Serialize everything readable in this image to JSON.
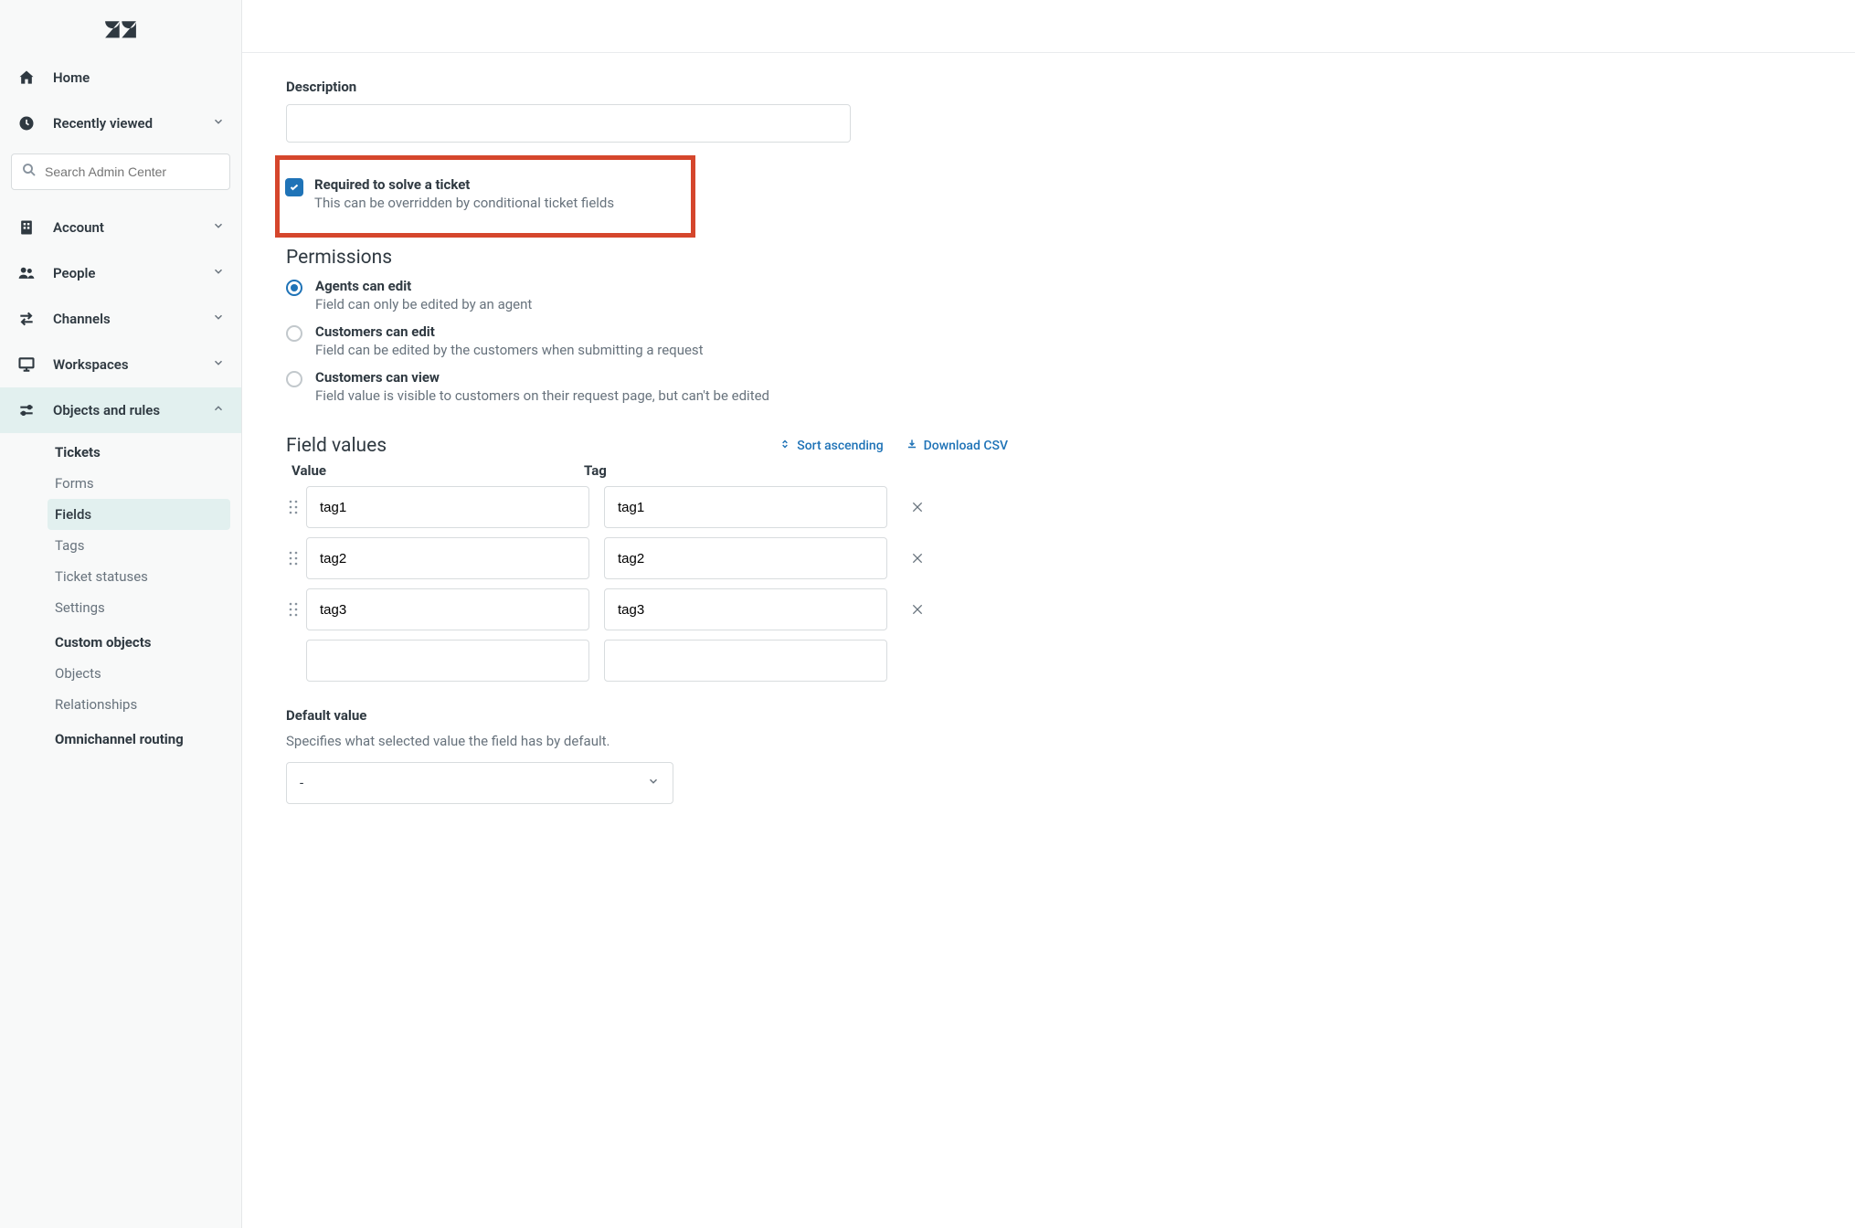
{
  "sidebar": {
    "home": "Home",
    "recent": "Recently viewed",
    "search_placeholder": "Search Admin Center",
    "sections": {
      "account": "Account",
      "people": "People",
      "channels": "Channels",
      "workspaces": "Workspaces",
      "objects": "Objects and rules"
    },
    "sub": {
      "tickets_head": "Tickets",
      "forms": "Forms",
      "fields": "Fields",
      "tags": "Tags",
      "ticket_statuses": "Ticket statuses",
      "settings": "Settings",
      "custom_objects_head": "Custom objects",
      "objects": "Objects",
      "relationships": "Relationships",
      "omni_head": "Omnichannel routing"
    }
  },
  "main": {
    "description_label": "Description",
    "description_value": "",
    "required": {
      "label": "Required to solve a ticket",
      "desc": "This can be overridden by conditional ticket fields",
      "checked": true
    },
    "permissions": {
      "title": "Permissions",
      "agents": {
        "label": "Agents can edit",
        "desc": "Field can only be edited by an agent"
      },
      "cust_edit": {
        "label": "Customers can edit",
        "desc": "Field can be edited by the customers when submitting a request"
      },
      "cust_view": {
        "label": "Customers can view",
        "desc": "Field value is visible to customers on their request page, but can't be edited"
      },
      "selected": "agents"
    },
    "field_values": {
      "title": "Field values",
      "sort": "Sort ascending",
      "download": "Download CSV",
      "col_value": "Value",
      "col_tag": "Tag",
      "rows": [
        {
          "value": "tag1",
          "tag": "tag1"
        },
        {
          "value": "tag2",
          "tag": "tag2"
        },
        {
          "value": "tag3",
          "tag": "tag3"
        }
      ]
    },
    "default": {
      "label": "Default value",
      "desc": "Specifies what selected value the field has by default.",
      "value": "-"
    }
  }
}
